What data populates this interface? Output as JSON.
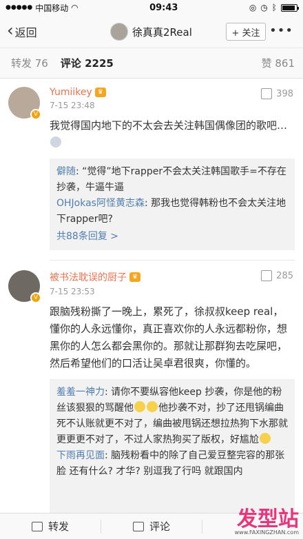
{
  "status_bar": {
    "carrier": "中国移动",
    "time": "09:43",
    "battery_level": 0.9
  },
  "nav": {
    "back_label": "返回",
    "title": "徐真真2Real",
    "follow_label": "+ 关注"
  },
  "tabs": {
    "repost": "转发 76",
    "comment": "评论 2225",
    "like": "赞 861"
  },
  "comments": [
    {
      "name": "Yumiikey",
      "time": "7-15 23:48",
      "likes": "398",
      "text": "我觉得国内地下的不太会去关注韩国偶像团的歌吧…",
      "replies": [
        {
          "user": "僻随",
          "text": ": “觉得”地下rapper不会太关注韩国歌手=不存在抄袭，牛逼牛逼"
        },
        {
          "user": "OHJokas阿怪黄志森",
          "text": ": 那我也觉得韩粉也不会太关注地下rapper吧?"
        }
      ],
      "more_replies": "共88条回复 >"
    },
    {
      "name": "被书法耽误的厨子",
      "time": "7-15 23:53",
      "likes": "285",
      "text": "跟脑残粉撕了一晚上，累死了，徐叔叔keep real，懂你的人永远懂你，真正喜欢你的人永远都粉你，想黑你的人怎么都会黑你的。那就让那群狗去吃屎吧，然后希望他们的口活让吴卓君很爽，你懂的。",
      "replies": [
        {
          "user": "羞羞一神力",
          "text": ": 请你不要纵容他keep 抄袭，你是他的粉丝该狠狠的骂醒他",
          "text2": "他抄袭不对，抄了还甩锅编曲死不认账就更不对了，编曲被甩锅还想拉热狗下水那就更更更不对了，不过人家热狗买了版权，好尴尬"
        },
        {
          "user": "下雨再见面",
          "text": ": 脑残粉看中的除了自己爱豆整完容的那张脸 还有什么? 才华? 别逗我了行吗 就跟国内"
        }
      ]
    }
  ],
  "bottom_bar": {
    "repost": "转发",
    "comment": "评论"
  },
  "watermark": {
    "logo": "发型站",
    "url": "www.FAXINGZHAN.com"
  }
}
